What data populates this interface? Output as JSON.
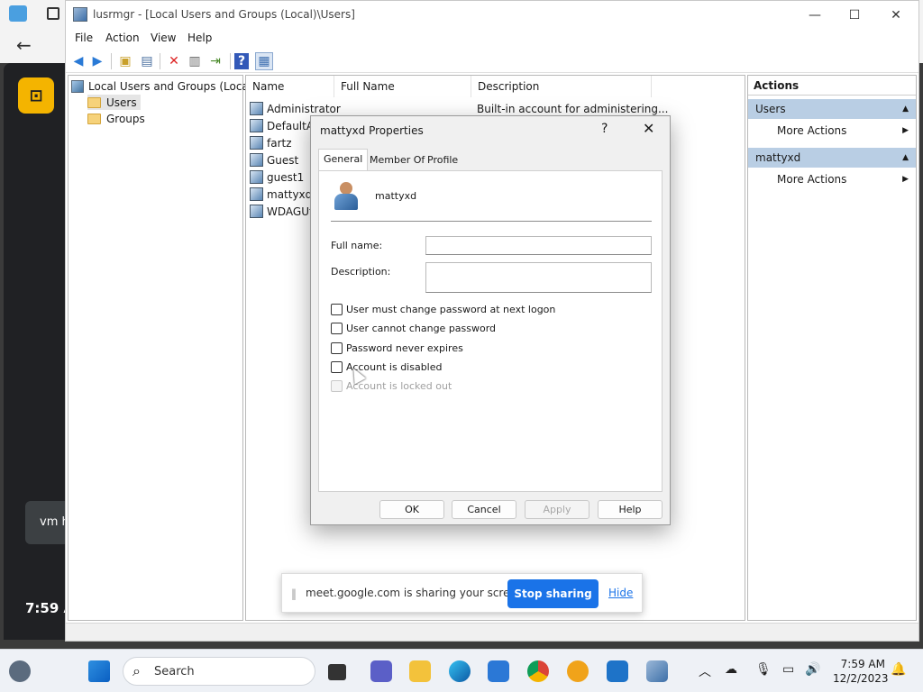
{
  "window": {
    "title": "lusrmgr - [Local Users and Groups (Local)\\Users]",
    "controls": {
      "minimize": "—",
      "maximize": "☐",
      "close": "✕"
    }
  },
  "menu": [
    "File",
    "Action",
    "View",
    "Help"
  ],
  "tree": {
    "root": "Local Users and Groups (Local)",
    "items": [
      "Users",
      "Groups"
    ]
  },
  "list": {
    "columns": [
      "Name",
      "Full Name",
      "Description"
    ],
    "rows": [
      {
        "name": "Administrator",
        "description": "Built-in account for administering..."
      },
      {
        "name": "DefaultAc",
        "description": ""
      },
      {
        "name": "fartz",
        "description": ""
      },
      {
        "name": "Guest",
        "description": ""
      },
      {
        "name": "guest1",
        "description": ""
      },
      {
        "name": "mattyxd",
        "description": ""
      },
      {
        "name": "WDAGUti",
        "description": ""
      }
    ]
  },
  "actions": {
    "header": "Actions",
    "groups": [
      {
        "title": "Users",
        "item": "More Actions"
      },
      {
        "title": "mattyxd",
        "item": "More Actions"
      }
    ]
  },
  "dialog": {
    "title": "mattyxd Properties",
    "help": "?",
    "close": "✕",
    "tabs": [
      "General",
      "Member Of",
      "Profile"
    ],
    "username": "mattyxd",
    "full_name_label": "Full name:",
    "full_name_value": "",
    "description_label": "Description:",
    "description_value": "",
    "checkboxes": [
      {
        "label": "User must change password at next logon",
        "checked": false,
        "enabled": true
      },
      {
        "label": "User cannot change password",
        "checked": false,
        "enabled": true
      },
      {
        "label": "Password never expires",
        "checked": false,
        "enabled": true
      },
      {
        "label": "Account is disabled",
        "checked": false,
        "enabled": true
      },
      {
        "label": "Account is locked out",
        "checked": false,
        "enabled": false
      }
    ],
    "buttons": {
      "ok": "OK",
      "cancel": "Cancel",
      "apply": "Apply",
      "help": "Help"
    }
  },
  "share_bar": {
    "message": "meet.google.com is sharing your screen.",
    "stop": "Stop sharing",
    "hide": "Hide"
  },
  "background": {
    "vm_text": "vm h",
    "time_text": "7:59 A"
  },
  "taskbar": {
    "search": "Search",
    "time": "7:59 AM",
    "date": "12/2/2023"
  }
}
